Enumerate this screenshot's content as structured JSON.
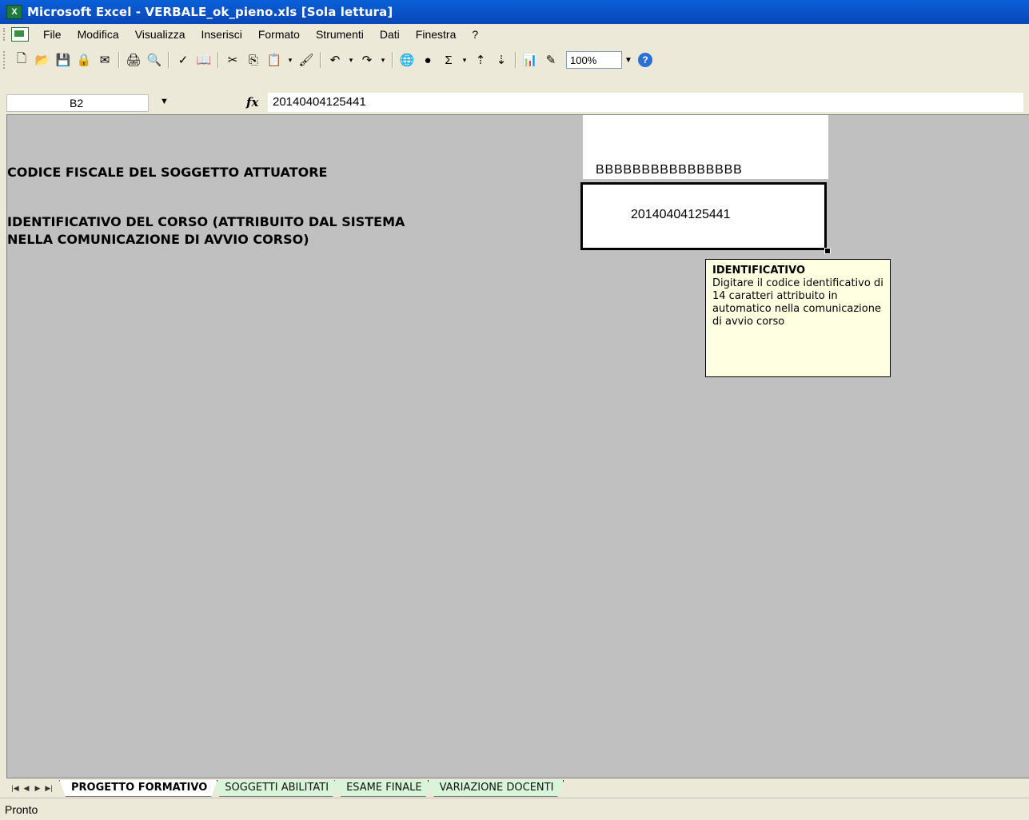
{
  "window": {
    "title": "Microsoft Excel - VERBALE_ok_pieno.xls  [Sola lettura]"
  },
  "menu": {
    "items": [
      "File",
      "Modifica",
      "Visualizza",
      "Inserisci",
      "Formato",
      "Strumenti",
      "Dati",
      "Finestra",
      "?"
    ]
  },
  "toolbar": {
    "zoom": "100%"
  },
  "formula_bar": {
    "name_box": "B2",
    "fx": "fx",
    "value": "20140404125441"
  },
  "sheet": {
    "label_codice": "CODICE FISCALE DEL SOGGETTO ATTUATORE",
    "label_identificativo_1": "IDENTIFICATIVO DEL CORSO (ATTRIBUITO DAL SISTEMA",
    "label_identificativo_2": "NELLA COMUNICAZIONE DI AVVIO CORSO)",
    "codice_value": "BBBBBBBBBBBBBBBB",
    "identificativo_value": "20140404125441"
  },
  "comment": {
    "title": "IDENTIFICATIVO",
    "body": "Digitare il codice identificativo di 14 caratteri attribuito in automatico nella comunicazione di avvio corso"
  },
  "tabs": [
    {
      "label": "PROGETTO FORMATIVO",
      "active": true
    },
    {
      "label": "SOGGETTI ABILITATI",
      "active": false
    },
    {
      "label": "ESAME FINALE",
      "active": false
    },
    {
      "label": "VARIAZIONE DOCENTI",
      "active": false
    }
  ],
  "status": {
    "text": "Pronto"
  }
}
